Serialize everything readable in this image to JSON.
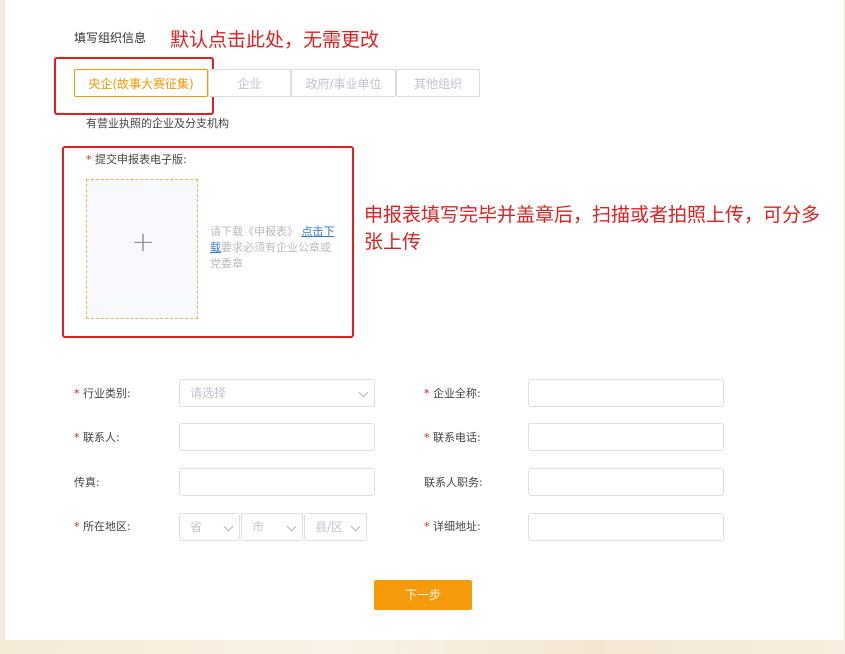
{
  "section_title": "填写组织信息",
  "annotations": {
    "default_note": "默认点击此处，无需更改",
    "upload_note": "申报表填写完毕并盖章后，扫描或者拍照上传，可分多张上传"
  },
  "org_tabs": [
    {
      "label": "央企(故事大赛征集)",
      "active": true
    },
    {
      "label": "企业",
      "active": false
    },
    {
      "label": "政府/事业单位",
      "active": false
    },
    {
      "label": "其他组织",
      "active": false
    }
  ],
  "org_hint": "有营业执照的企业及分支机构",
  "upload": {
    "required_mark": "*",
    "label": "提交申报表电子版:",
    "plus": "+",
    "hint_prefix": "请下载《申报表》",
    "hint_link": "点击下载",
    "hint_suffix": "要求必须有企业公章或党委章"
  },
  "form": {
    "industry": {
      "label": "行业类别:",
      "required": true,
      "placeholder": "请选择"
    },
    "company_name": {
      "label": "企业全称:",
      "required": true,
      "value": ""
    },
    "contact": {
      "label": "联系人:",
      "required": true,
      "value": ""
    },
    "phone": {
      "label": "联系电话:",
      "required": true,
      "value": ""
    },
    "fax": {
      "label": "传真:",
      "required": false,
      "value": ""
    },
    "position": {
      "label": "联系人职务:",
      "required": false,
      "value": ""
    },
    "region": {
      "label": "所在地区:",
      "required": true,
      "province": "省",
      "city": "市",
      "county": "县/区"
    },
    "address": {
      "label": "详细地址:",
      "required": true,
      "value": ""
    }
  },
  "next_button": "下一步",
  "colors": {
    "accent": "#f59b0b",
    "annotation": "#e02020",
    "required": "#e02020",
    "link": "#3a7bd5"
  }
}
